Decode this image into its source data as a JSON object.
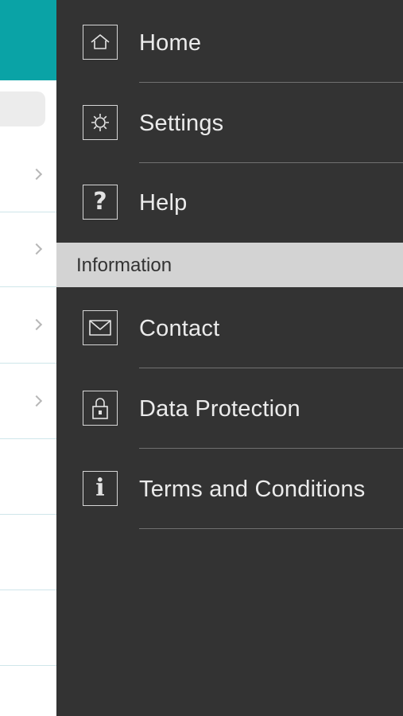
{
  "drawer": {
    "items": [
      {
        "label": "Home",
        "icon": "home-icon"
      },
      {
        "label": "Settings",
        "icon": "gear-icon"
      },
      {
        "label": "Help",
        "icon": "help-icon",
        "glyph": "?"
      }
    ],
    "section": {
      "title": "Information"
    },
    "info_items": [
      {
        "label": "Contact",
        "icon": "envelope-icon"
      },
      {
        "label": "Data Protection",
        "icon": "lock-icon"
      },
      {
        "label": "Terms and Conditions",
        "icon": "info-icon",
        "glyph": "i"
      }
    ]
  },
  "colors": {
    "drawer_bg": "#333333",
    "header_teal": "#0aa3a6",
    "section_bg": "#d3d3d3",
    "text_light": "#ebebeb"
  }
}
